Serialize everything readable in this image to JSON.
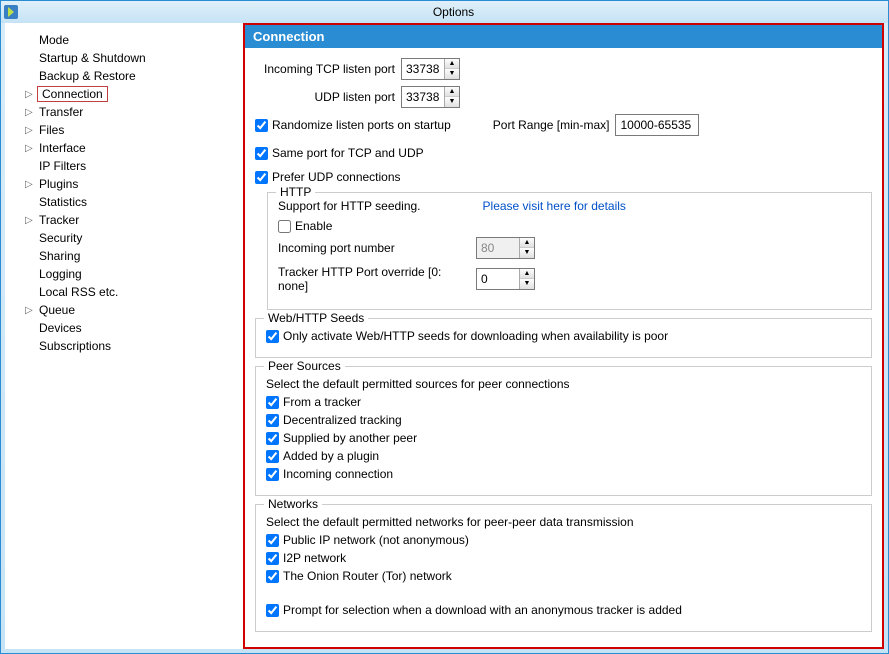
{
  "window": {
    "title": "Options"
  },
  "sidebar": {
    "items": [
      {
        "label": "Mode",
        "arrow": ""
      },
      {
        "label": "Startup & Shutdown",
        "arrow": ""
      },
      {
        "label": "Backup & Restore",
        "arrow": ""
      },
      {
        "label": "Connection",
        "arrow": "▷",
        "selected": true
      },
      {
        "label": "Transfer",
        "arrow": "▷"
      },
      {
        "label": "Files",
        "arrow": "▷"
      },
      {
        "label": "Interface",
        "arrow": "▷"
      },
      {
        "label": "IP Filters",
        "arrow": ""
      },
      {
        "label": "Plugins",
        "arrow": "▷"
      },
      {
        "label": "Statistics",
        "arrow": ""
      },
      {
        "label": "Tracker",
        "arrow": "▷"
      },
      {
        "label": "Security",
        "arrow": ""
      },
      {
        "label": "Sharing",
        "arrow": ""
      },
      {
        "label": "Logging",
        "arrow": ""
      },
      {
        "label": "Local RSS etc.",
        "arrow": ""
      },
      {
        "label": "Queue",
        "arrow": "▷"
      },
      {
        "label": "Devices",
        "arrow": ""
      },
      {
        "label": "Subscriptions",
        "arrow": ""
      }
    ]
  },
  "panel": {
    "header": "Connection",
    "tcp_label": "Incoming TCP listen port",
    "tcp_value": "33738",
    "udp_label": "UDP listen port",
    "udp_value": "33738",
    "randomize_label": "Randomize listen ports on startup",
    "randomize_checked": true,
    "port_range_label": "Port Range [min-max]",
    "port_range_value": "10000-65535",
    "same_port_label": "Same port for TCP and UDP",
    "same_port_checked": true,
    "prefer_udp_label": "Prefer UDP connections",
    "prefer_udp_checked": true,
    "http": {
      "legend": "HTTP",
      "support_text": "Support for HTTP seeding.",
      "link_text": "Please visit here for details",
      "enable_label": "Enable",
      "enable_checked": false,
      "incoming_port_label": "Incoming port number",
      "incoming_port_value": "80",
      "tracker_override_label": "Tracker HTTP Port override [0: none]",
      "tracker_override_value": "0"
    },
    "webseeds": {
      "legend": "Web/HTTP Seeds",
      "only_activate_label": "Only activate Web/HTTP seeds for downloading when availability is poor",
      "only_activate_checked": true
    },
    "peersources": {
      "legend": "Peer Sources",
      "description": "Select the default permitted sources for peer connections",
      "items": [
        {
          "label": "From a tracker",
          "checked": true
        },
        {
          "label": "Decentralized tracking",
          "checked": true
        },
        {
          "label": "Supplied by another peer",
          "checked": true
        },
        {
          "label": "Added by a plugin",
          "checked": true
        },
        {
          "label": "Incoming connection",
          "checked": true
        }
      ]
    },
    "networks": {
      "legend": "Networks",
      "description": "Select the default permitted networks for peer-peer data transmission",
      "items": [
        {
          "label": "Public IP network (not anonymous)",
          "checked": true
        },
        {
          "label": "I2P network",
          "checked": true
        },
        {
          "label": "The Onion Router (Tor) network",
          "checked": true
        }
      ],
      "prompt_label": "Prompt for selection when a download with an anonymous tracker is added",
      "prompt_checked": true
    }
  }
}
